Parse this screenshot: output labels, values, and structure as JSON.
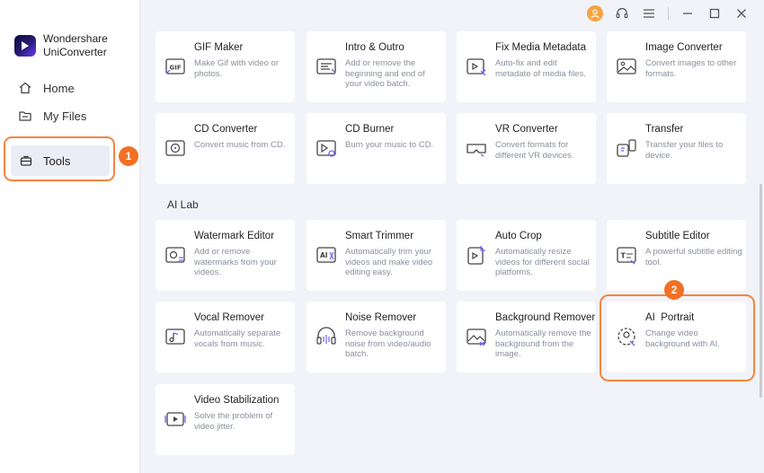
{
  "app": {
    "name": "Wondershare UniConverter"
  },
  "sidebar": {
    "items": [
      {
        "label": "Home",
        "icon": "home-icon"
      },
      {
        "label": "My Files",
        "icon": "folder-icon"
      },
      {
        "label": "Tools",
        "icon": "toolbox-icon",
        "active": true
      }
    ]
  },
  "annotations": {
    "badge1": "1",
    "badge2": "2"
  },
  "section": {
    "ai_lab": "AI Lab"
  },
  "tools": [
    {
      "title": "GIF Maker",
      "desc": "Make Gif with video or photos.",
      "icon": "gif-icon"
    },
    {
      "title": "Intro & Outro",
      "desc": "Add or remove the beginning and end of your video batch.",
      "icon": "intro-outro-icon"
    },
    {
      "title": "Fix Media Metadata",
      "desc": "Auto-fix and edit metadate of media files.",
      "icon": "metadata-icon"
    },
    {
      "title": "Image Converter",
      "desc": "Convert images to other formats.",
      "icon": "image-icon"
    },
    {
      "title": "CD Converter",
      "desc": "Convert music from CD.",
      "icon": "cd-icon"
    },
    {
      "title": "CD Burner",
      "desc": "Burn your music to CD.",
      "icon": "cd-burner-icon"
    },
    {
      "title": "VR Converter",
      "desc": "Convert formats for different VR devices.",
      "icon": "vr-icon"
    },
    {
      "title": "Transfer",
      "desc": "Transfer your files to device.",
      "icon": "transfer-icon"
    }
  ],
  "ai_tools": [
    {
      "title": "Watermark Editor",
      "desc": "Add or remove watermarks from your videos.",
      "icon": "watermark-icon"
    },
    {
      "title": "Smart Trimmer",
      "desc": "Automatically trim your videos and make video editing easy.",
      "icon": "ai-trim-icon"
    },
    {
      "title": "Auto Crop",
      "desc": "Automatically resize videos for different social platforms.",
      "icon": "crop-icon"
    },
    {
      "title": "Subtitle Editor",
      "desc": "A powerful subtitle editing tool.",
      "icon": "subtitle-icon"
    },
    {
      "title": "Vocal Remover",
      "desc": "Automatically separate vocals from music.",
      "icon": "vocal-icon"
    },
    {
      "title": "Noise Remover",
      "desc": "Remove background noise from video/audio batch.",
      "icon": "headphones-icon"
    },
    {
      "title": "Background Remover",
      "desc": "Automatically remove the background from the image.",
      "icon": "bg-remove-icon"
    },
    {
      "title": "AI  Portrait",
      "desc": "Change video background with AI.",
      "icon": "portrait-icon"
    },
    {
      "title": "Video Stabilization",
      "desc": "Solve the problem of video jitter.",
      "icon": "stabilize-icon"
    }
  ],
  "colors": {
    "accent": "#f5853f",
    "badge": "#f27024",
    "icon_accent": "#7b5cff",
    "avatar": "#f6a342"
  }
}
